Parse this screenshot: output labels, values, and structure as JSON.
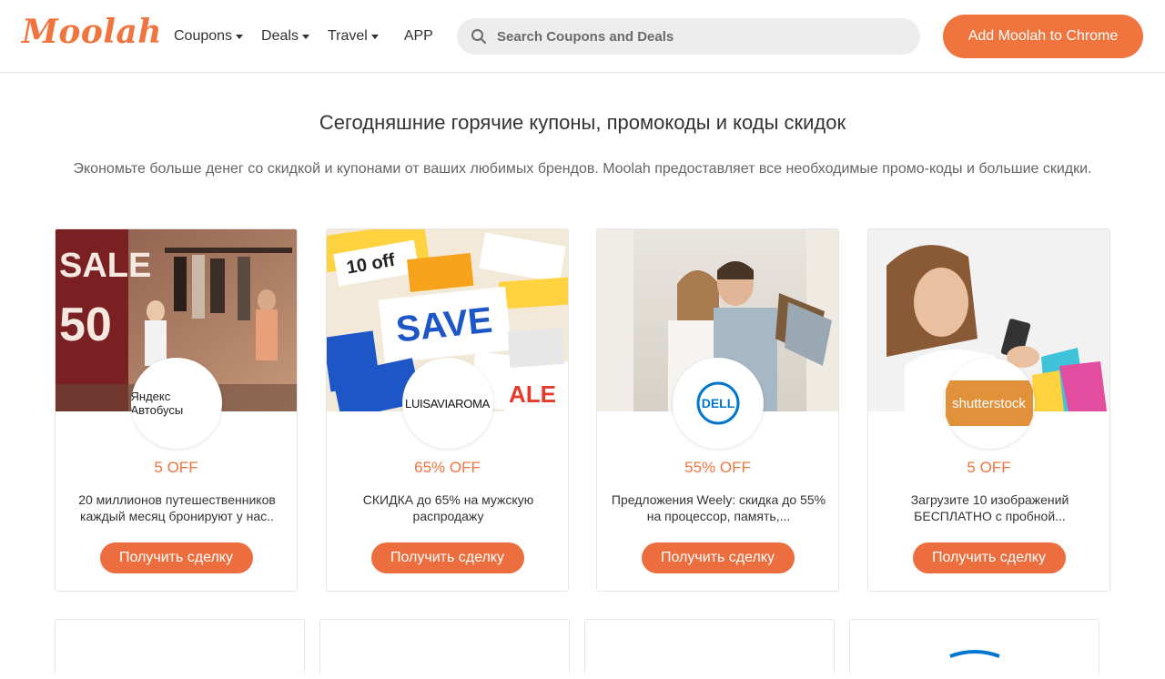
{
  "header": {
    "logo": "Moolah",
    "nav": [
      {
        "label": "Coupons",
        "dropdown": true
      },
      {
        "label": "Deals",
        "dropdown": true
      },
      {
        "label": "Travel",
        "dropdown": true
      },
      {
        "label": "APP",
        "dropdown": false
      }
    ],
    "search_placeholder": "Search Coupons and Deals",
    "cta_label": "Add Moolah to Chrome"
  },
  "main": {
    "headline": "Сегодняшние горячие купоны, промокоды и коды скидок",
    "subline": "Экономьте больше денег со скидкой и купонами от ваших любимых брендов. Moolah предоставляет все необходимые промо-коды и большие скидки."
  },
  "cards": [
    {
      "brand": "Яндекс Автобусы",
      "offer": "5 OFF",
      "description": "20 миллионов путешественников каждый месяц бронируют у нас..",
      "button": "Получить сделку",
      "image": "sale-50-store"
    },
    {
      "brand": "LUISAVIAROMA",
      "offer": "65% OFF",
      "description": "СКИДКА до 65% на мужскую распродажу",
      "button": "Получить сделку",
      "image": "coupons-save"
    },
    {
      "brand": "DELL",
      "offer": "55% OFF",
      "description": "Предложения Weely: скидка до 55% на процессор, память,...",
      "button": "Получить сделку",
      "image": "couple-shopping"
    },
    {
      "brand": "shutterstock",
      "offer": "5 OFF",
      "description": "Загрузите 10 изображений БЕСПЛАТНО с пробной...",
      "button": "Получить сделку",
      "image": "woman-phone"
    }
  ],
  "colors": {
    "accent": "#f0743e",
    "button": "#ec6d3d",
    "dell_blue": "#0076ce",
    "shutterstock_bg": "#e2913b"
  }
}
